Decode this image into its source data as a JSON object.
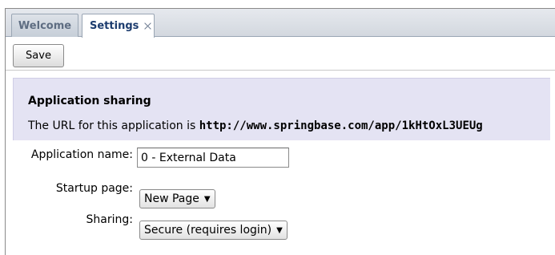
{
  "tabs": [
    {
      "label": "Welcome",
      "active": false
    },
    {
      "label": "Settings",
      "active": true,
      "closable": true
    }
  ],
  "toolbar": {
    "save_label": "Save"
  },
  "sharing_panel": {
    "title": "Application sharing",
    "text_prefix": "The URL for this application is ",
    "url": "http://www.springbase.com/app/1kHtOxL3UEUg"
  },
  "form": {
    "app_name": {
      "label": "Application name:",
      "value": "0 - External Data"
    },
    "startup_page": {
      "label": "Startup page:",
      "value": "New Page"
    },
    "sharing": {
      "label": "Sharing:",
      "value": "Secure (requires login)"
    }
  },
  "icons": {
    "tab_close": "close-icon",
    "dropdown": "caret-down-icon"
  },
  "colors": {
    "panel_bg": "#e4e3f3",
    "active_tab_text": "#1c3c6e",
    "inactive_tab_text": "#5e6d82"
  }
}
